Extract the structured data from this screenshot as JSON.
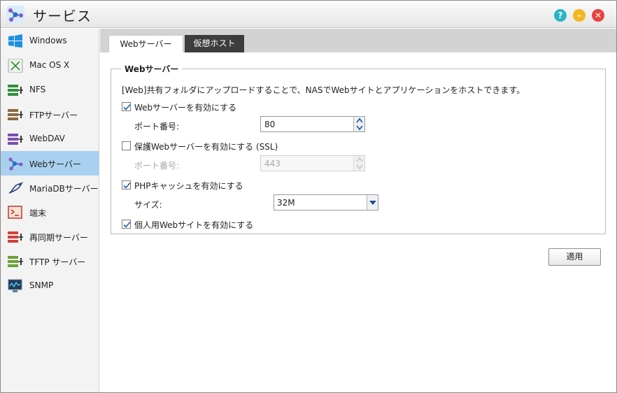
{
  "window": {
    "title": "サービス",
    "help_symbol": "?",
    "minimize_symbol": "–",
    "close_symbol": "✕"
  },
  "sidebar": {
    "items": [
      {
        "label": "Windows",
        "icon": "windows-icon"
      },
      {
        "label": "Mac OS X",
        "icon": "mac-os-icon"
      },
      {
        "label": "NFS",
        "icon": "nfs-icon"
      },
      {
        "label": "FTPサーバー",
        "icon": "ftp-server-icon"
      },
      {
        "label": "WebDAV",
        "icon": "webdav-icon"
      },
      {
        "label": "Webサーバー",
        "icon": "web-server-icon",
        "active": true
      },
      {
        "label": "MariaDBサーバー",
        "icon": "mariadb-icon"
      },
      {
        "label": "端末",
        "icon": "terminal-icon"
      },
      {
        "label": "再同期サーバー",
        "icon": "rsync-server-icon"
      },
      {
        "label": "TFTP サーバー",
        "icon": "tftp-server-icon"
      },
      {
        "label": "SNMP",
        "icon": "snmp-icon"
      }
    ]
  },
  "tabs": [
    {
      "label": "Webサーバー",
      "active": true
    },
    {
      "label": "仮想ホスト",
      "active": false
    }
  ],
  "web_server": {
    "legend": "Webサーバー",
    "description": "[Web]共有フォルダにアップロードすることで、NASでWebサイトとアプリケーションをホストできます。",
    "enable_web_server": {
      "label": "Webサーバーを有効にする",
      "checked": true
    },
    "port": {
      "label": "ポート番号:",
      "value": "80"
    },
    "enable_ssl": {
      "label": "保護Webサーバーを有効にする (SSL)",
      "checked": false
    },
    "ssl_port": {
      "label": "ポート番号:",
      "value": "443",
      "disabled": true
    },
    "enable_php_cache": {
      "label": "PHPキャッシュを有効にする",
      "checked": true
    },
    "size": {
      "label": "サイズ:",
      "value": "32M"
    },
    "enable_personal_site": {
      "label": "個人用Webサイトを有効にする",
      "checked": true
    }
  },
  "apply_button": "適用",
  "colors": {
    "sidebar_active": "#a9d1ef",
    "tab_inactive": "#3d3d3d",
    "checkbox_check": "#1f5fa8",
    "help": "#2ab3c6",
    "minimize": "#f2b81e",
    "close": "#e8413f"
  }
}
